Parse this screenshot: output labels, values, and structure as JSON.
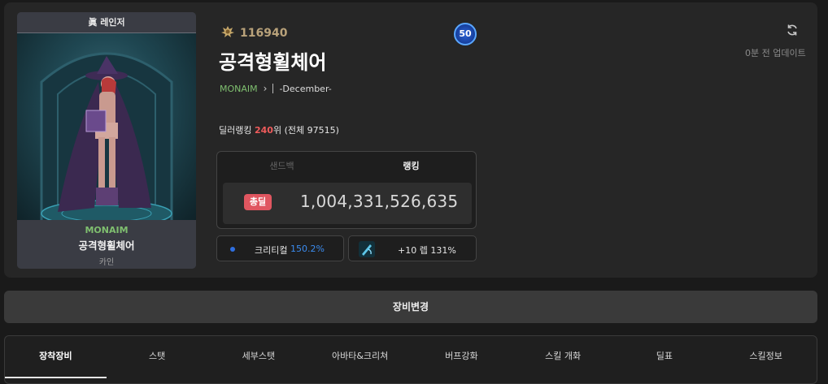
{
  "portrait": {
    "title": "眞 레인저",
    "guild": "MONAIM",
    "name": "공격형휠체어",
    "server": "카인"
  },
  "profile": {
    "fame_icon": "fame-crest-icon",
    "fame": "116940",
    "level": "50",
    "name": "공격형휠체어",
    "guild": "MONAIM",
    "adventure": "-December-",
    "updated": "0분 전 업데이트"
  },
  "ranking": {
    "prefix": "딜러랭킹",
    "rank": "240",
    "suffix": "위 (전체 97515)"
  },
  "damage": {
    "tab_sandbag": "샌드백",
    "tab_ranking": "랭킹",
    "badge": "총딜",
    "value": "1,004,331,526,635"
  },
  "stats": {
    "crit_label": "크리티컬",
    "crit_value": "150.2%",
    "weapon_text": "+10 렙 131%"
  },
  "equip_button": "장비변경",
  "tabs": [
    "장착장비",
    "스탯",
    "세부스탯",
    "아바타&크리쳐",
    "버프강화",
    "스킬 개화",
    "딜표",
    "스킬정보"
  ],
  "colors": {
    "accent_red": "#ef5b5b",
    "guild_green": "#7fbf6f",
    "crit_blue": "#3b8cf0"
  }
}
